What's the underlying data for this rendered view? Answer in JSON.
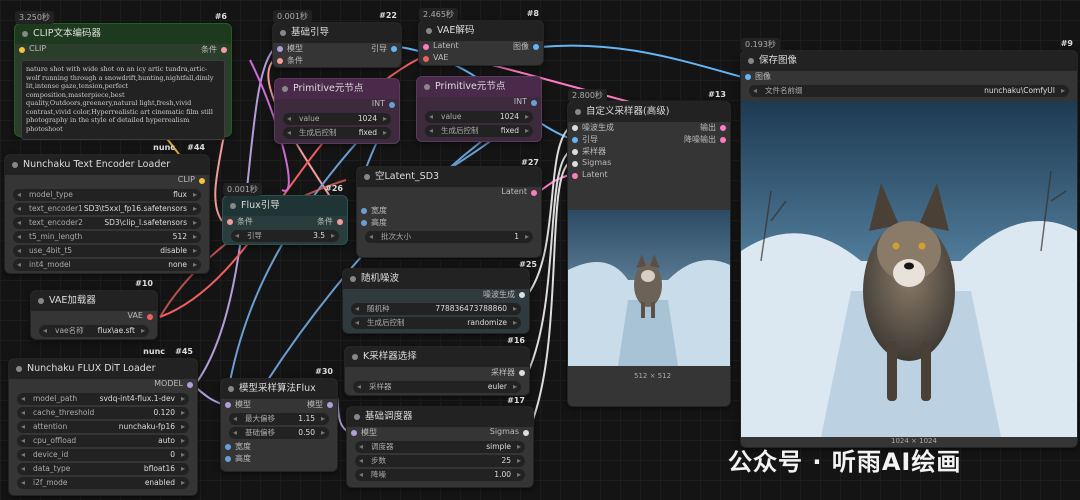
{
  "colors": {
    "wire_clip": "#f7c03c",
    "wire_cond": "#f29c9c",
    "wire_latent": "#ff7ac0",
    "wire_model": "#b39ddb",
    "wire_vae": "#f06060",
    "wire_image": "#64b5f6",
    "wire_int": "#6b9fd4"
  },
  "nodes": {
    "clip_encode": {
      "time": "3.250秒",
      "id": "#6",
      "title": "CLIP文本编码器",
      "input": "CLIP",
      "output": "条件",
      "prompt": "nature shot with wide shot on an icy artic tundra,artic-wolf running through a snowdrift,hunting,nightfall,dimly lit,intense gaze,tension,perfect composition,masterpiece,best quality,Outdoors,greenery,natural light,fresh,vivid contrast,vivid color,Hyperrealistic art cinematic film still photography in the style of detailed hyperrealism photoshoot"
    },
    "text_loader": {
      "id": "#44",
      "badge": "nunc",
      "title": "Nunchaku Text Encoder Loader",
      "output": "CLIP",
      "widgets": [
        {
          "label": "model_type",
          "value": "flux"
        },
        {
          "label": "text_encoder1",
          "value": "SD3\\t5xxl_fp16.safetensors"
        },
        {
          "label": "text_encoder2",
          "value": "SD3\\clip_l.safetensors"
        },
        {
          "label": "t5_min_length",
          "value": "512"
        },
        {
          "label": "use_4bit_t5",
          "value": "disable"
        },
        {
          "label": "int4_model",
          "value": "none"
        }
      ]
    },
    "vae_loader": {
      "id": "#10",
      "title": "VAE加载器",
      "output": "VAE",
      "widgets": [
        {
          "label": "vae名称",
          "value": "flux\\ae.sft"
        }
      ]
    },
    "dit_loader": {
      "id": "#45",
      "badge": "nunc",
      "title": "Nunchaku FLUX DiT Loader",
      "output": "MODEL",
      "widgets": [
        {
          "label": "model_path",
          "value": "svdq-int4-flux.1-dev"
        },
        {
          "label": "cache_threshold",
          "value": "0.120"
        },
        {
          "label": "attention",
          "value": "nunchaku-fp16"
        },
        {
          "label": "cpu_offload",
          "value": "auto"
        },
        {
          "label": "device_id",
          "value": "0"
        },
        {
          "label": "data_type",
          "value": "bfloat16"
        },
        {
          "label": "i2f_mode",
          "value": "enabled"
        }
      ]
    },
    "basic_guider": {
      "time": "0.001秒",
      "id": "#22",
      "title": "基础引导",
      "inputs": [
        "模型",
        "条件"
      ],
      "output": "引导"
    },
    "prim1": {
      "id": "",
      "title": "Primitive元节点",
      "output": "INT",
      "widgets": [
        {
          "label": "value",
          "value": "1024"
        },
        {
          "label": "生成后控制",
          "value": "fixed"
        }
      ]
    },
    "prim2": {
      "id": "#27",
      "title": "Primitive元节点",
      "output": "INT",
      "widgets": [
        {
          "label": "value",
          "value": "1024"
        },
        {
          "label": "生成后控制",
          "value": "fixed"
        }
      ]
    },
    "vae_decode": {
      "time": "2.465秒",
      "id": "#8",
      "title": "VAE解码",
      "inputs": [
        "Latent",
        "VAE"
      ],
      "output": "图像"
    },
    "flux_guide": {
      "time": "0.001秒",
      "id": "#26",
      "title": "Flux引导",
      "input": "条件",
      "output": "条件",
      "widgets": [
        {
          "label": "引导",
          "value": "3.5"
        }
      ]
    },
    "empty_latent": {
      "id": "#25",
      "title": "空Latent_SD3",
      "inputs": [
        "宽度",
        "高度"
      ],
      "output": "Latent",
      "widgets": [
        {
          "label": "批次大小",
          "value": "1"
        }
      ]
    },
    "noise": {
      "id": "#16",
      "title": "随机噪波",
      "output": "噪波生成",
      "widgets": [
        {
          "label": "随机种",
          "value": "778836473788860"
        },
        {
          "label": "生成后控制",
          "value": "randomize"
        }
      ]
    },
    "sampler_sel": {
      "id": "#17",
      "title": "K采样器选择",
      "output": "采样器",
      "widgets": [
        {
          "label": "采样器",
          "value": "euler"
        }
      ]
    },
    "model_sampling": {
      "id": "#30",
      "title": "模型采样算法Flux",
      "inputs": [
        "模型",
        "宽度",
        "高度"
      ],
      "output": "模型",
      "widgets": [
        {
          "label": "最大偏移",
          "value": "1.15"
        },
        {
          "label": "基础偏移",
          "value": "0.50"
        }
      ]
    },
    "scheduler": {
      "id": "",
      "title": "基础调度器",
      "input": "模型",
      "output": "Sigmas",
      "widgets": [
        {
          "label": "调度器",
          "value": "simple"
        },
        {
          "label": "步数",
          "value": "25"
        },
        {
          "label": "降噪",
          "value": "1.00"
        }
      ]
    },
    "custom_sampler": {
      "time": "2.800秒",
      "id": "#13",
      "title": "自定义采样器(高级)",
      "inputs": [
        "噪波生成",
        "引导",
        "采样器",
        "Sigmas",
        "Latent"
      ],
      "outputs": [
        "输出",
        "降噪输出"
      ],
      "caption": "512 × 512"
    },
    "save_image": {
      "time": "0.193秒",
      "id": "#9",
      "title": "保存图像",
      "input": "图像",
      "widgets": [
        {
          "label": "文件名前缀",
          "value": "nunchaku\\ComfyUI"
        }
      ],
      "caption": "1024 × 1024"
    }
  },
  "watermark": "公众号 · 听雨AI绘画"
}
